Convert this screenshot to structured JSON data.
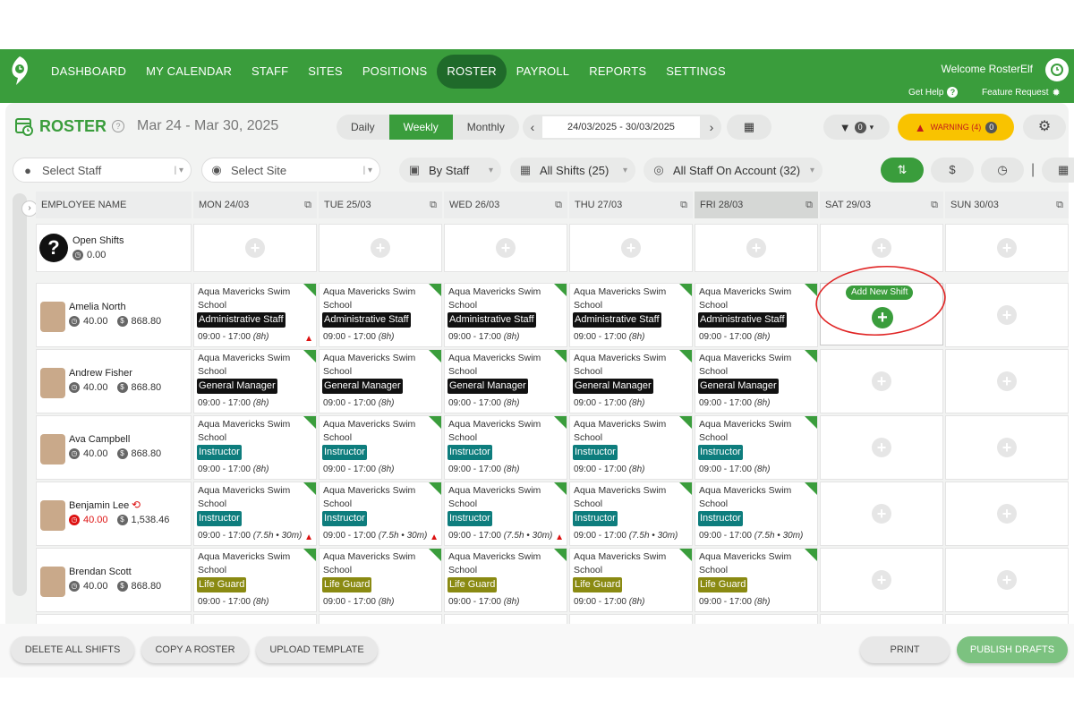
{
  "nav": {
    "items": [
      "DASHBOARD",
      "MY CALENDAR",
      "STAFF",
      "SITES",
      "POSITIONS",
      "ROSTER",
      "PAYROLL",
      "REPORTS",
      "SETTINGS"
    ],
    "active": "ROSTER",
    "welcome": "Welcome RosterElf",
    "get_help": "Get Help",
    "feature_request": "Feature Request"
  },
  "roster": {
    "title": "ROSTER",
    "date_range": "Mar 24 - Mar 30, 2025",
    "views": [
      "Daily",
      "Weekly",
      "Monthly"
    ],
    "active_view": "Weekly",
    "date_value": "24/03/2025 - 30/03/2025",
    "filter_count": "0",
    "warning_label": "WARNING (4)",
    "warning_count": "0"
  },
  "filters": {
    "staff_placeholder": "Select Staff",
    "site_placeholder": "Select Site",
    "group_by": "By Staff",
    "shifts": "All Shifts (25)",
    "staff_scope": "All Staff On Account (32)"
  },
  "grid": {
    "employee_header": "EMPLOYEE NAME",
    "days": [
      "MON 24/03",
      "TUE 25/03",
      "WED 26/03",
      "THU 27/03",
      "FRI 28/03",
      "SAT 29/03",
      "SUN 30/03"
    ],
    "today_index": 4,
    "open_shifts": {
      "label": "Open Shifts",
      "hours": "0.00"
    },
    "add_new_shift_label": "Add New Shift",
    "site_name": "Aqua Mavericks Swim School",
    "employees": [
      {
        "name": "Amelia North",
        "hours": "40.00",
        "pay": "868.80",
        "hours_alert": false,
        "role": "Administrative Staff",
        "role_color": "black",
        "time": "09:00 - 17:00 ",
        "dur": "(8h)",
        "warn_days": [
          0
        ]
      },
      {
        "name": "Andrew Fisher",
        "hours": "40.00",
        "pay": "868.80",
        "hours_alert": false,
        "role": "General Manager",
        "role_color": "black",
        "time": "09:00 - 17:00 ",
        "dur": "(8h)",
        "warn_days": []
      },
      {
        "name": "Ava Campbell",
        "hours": "40.00",
        "pay": "868.80",
        "hours_alert": false,
        "role": "Instructor",
        "role_color": "teal",
        "time": "09:00 - 17:00 ",
        "dur": "(8h)",
        "warn_days": []
      },
      {
        "name": "Benjamin Lee",
        "hours": "40.00",
        "pay": "1,538.46",
        "hours_alert": true,
        "role": "Instructor",
        "role_color": "teal",
        "time": "09:00 - 17:00 ",
        "dur": "(7.5h • 30m)",
        "warn_days": [
          0,
          1,
          2
        ]
      },
      {
        "name": "Brendan Scott",
        "hours": "40.00",
        "pay": "868.80",
        "hours_alert": false,
        "role": "Life Guard",
        "role_color": "olive",
        "time": "09:00 - 17:00 ",
        "dur": "(8h)",
        "warn_days": []
      }
    ]
  },
  "bottom": {
    "delete_all": "DELETE ALL SHIFTS",
    "copy_roster": "COPY A ROSTER",
    "upload_template": "UPLOAD TEMPLATE",
    "print": "PRINT",
    "publish": "PUBLISH DRAFTS"
  },
  "colors": {
    "brand": "#3a9d3c",
    "nav_active": "#1f6a2a",
    "warning": "#f9c300"
  }
}
